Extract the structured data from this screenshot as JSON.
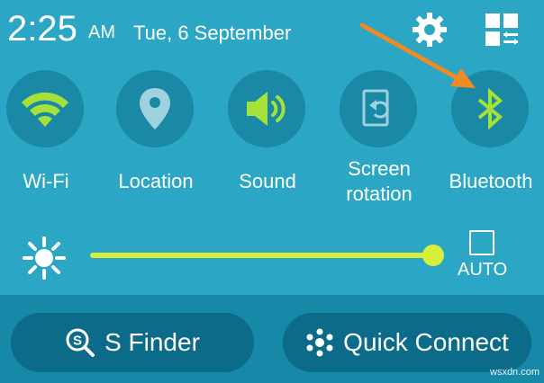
{
  "status": {
    "time": "2:25",
    "ampm": "AM",
    "date": "Tue, 6 September"
  },
  "header_icons": [
    "gear-icon",
    "grid-edit-icon"
  ],
  "toggles": [
    {
      "label": "Wi-Fi",
      "icon": "wifi-icon",
      "active": true
    },
    {
      "label": "Location",
      "icon": "location-pin-icon",
      "active": false
    },
    {
      "label": "Sound",
      "icon": "speaker-icon",
      "active": true
    },
    {
      "label_line1": "Screen",
      "label_line2": "rotation",
      "icon": "screen-rotation-icon",
      "active": false
    },
    {
      "label": "Bluetooth",
      "icon": "bluetooth-icon",
      "active": true
    }
  ],
  "brightness": {
    "level": 1.0,
    "auto_label": "AUTO",
    "auto_checked": false
  },
  "buttons": {
    "sfinder_label": "S Finder",
    "quick_connect_label": "Quick Connect"
  },
  "watermark": "wsxdn.com",
  "colors": {
    "panel": "#2ba6c4",
    "toggle_bg": "#1989a6",
    "active_accent": "#a6e13a",
    "slider": "#d7ef3b",
    "annotation_arrow": "#f08a22"
  }
}
